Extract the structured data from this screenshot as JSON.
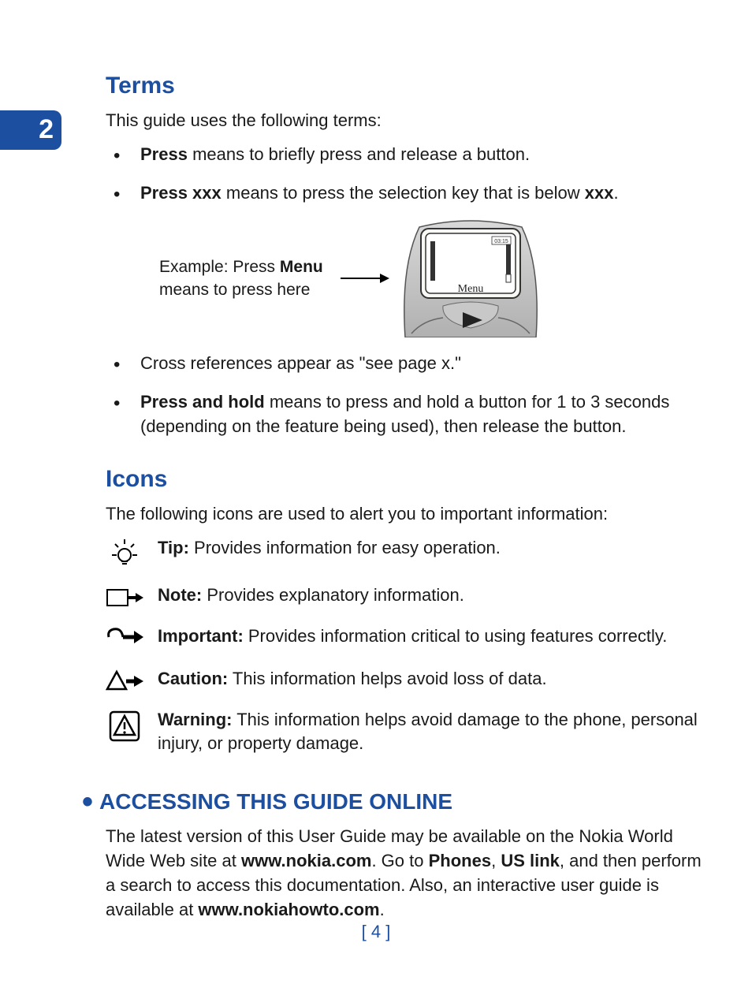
{
  "chapter_number": "2",
  "terms": {
    "heading": "Terms",
    "intro": "This guide uses the following terms:",
    "items": [
      {
        "bold": "Press",
        "rest": " means to briefly press and release a button."
      },
      {
        "bold": "Press xxx",
        "rest": " means to press the selection key that is below ",
        "bold2": "xxx",
        "rest2": "."
      }
    ],
    "example_prefix": "Example: Press ",
    "example_bold": "Menu",
    "example_suffix": " means to press here",
    "items2": [
      {
        "bold": "",
        "rest": "Cross references appear as \"see page x.\""
      },
      {
        "bold": "Press and hold",
        "rest": " means to press and hold a button for 1 to 3 seconds (depending on the feature being used), then release the button."
      }
    ]
  },
  "icons": {
    "heading": "Icons",
    "intro": "The following icons are used to alert you to important information:",
    "rows": [
      {
        "label": "Tip:",
        "desc": " Provides information for easy operation."
      },
      {
        "label": "Note:",
        "desc": " Provides explanatory information."
      },
      {
        "label": "Important:",
        "desc": " Provides information critical to using features correctly."
      },
      {
        "label": "Caution:",
        "desc": " This information helps avoid loss of data."
      },
      {
        "label": "Warning:",
        "desc": " This information helps avoid damage to the phone, personal injury, or property damage."
      }
    ]
  },
  "accessing": {
    "heading": "ACCESSING THIS GUIDE ONLINE",
    "p1": "The latest version of this User Guide may be available on the Nokia World Wide Web site at ",
    "b1": "www.nokia.com",
    "p2": ". Go to ",
    "b2": "Phones",
    "p3": ", ",
    "b3": "US link",
    "p4": ", and then perform a search to access this documentation. Also, an interactive user guide is available at ",
    "b4": "www.nokiahowto.com",
    "p5": "."
  },
  "phone": {
    "menu_label": "Menu",
    "time": "03:15"
  },
  "page_number": "[ 4 ]"
}
